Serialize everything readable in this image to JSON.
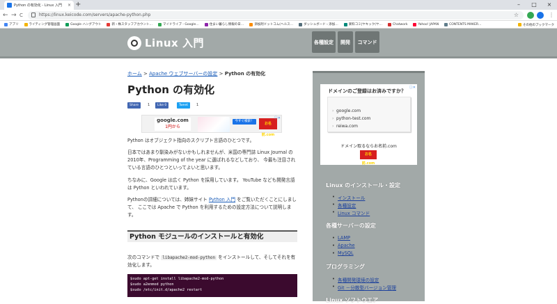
{
  "browser": {
    "tab_title": "Python の有効化 - Linux 入門",
    "tab_close": "×",
    "new_tab": "+",
    "win_min": "–",
    "win_max": "□",
    "win_close": "×",
    "back": "←",
    "forward": "→",
    "reload": "C",
    "url": "https://linux.keicode.com/servers/apache-python.php",
    "star": "☆",
    "bookmarks": [
      {
        "label": "アプリ",
        "color": "#4285f4"
      },
      {
        "label": "ライティング管理画面",
        "color": "#f4b400"
      },
      {
        "label": "Google ハングアウト",
        "color": "#0f9d58"
      },
      {
        "label": "新・株スタッフアカウント…",
        "color": "#e53935"
      },
      {
        "label": "マイドライブ - Google…",
        "color": "#34a853"
      },
      {
        "label": "住まい暮らし情報の日…",
        "color": "#8e24aa"
      },
      {
        "label": "添加剤ドットコム(ヘルス…",
        "color": "#fb8c00"
      },
      {
        "label": "ダッシュボード ‹ 添加…",
        "color": "#546e7a"
      },
      {
        "label": "楽料コミ|ヤキック(ヤ…",
        "color": "#00897b"
      },
      {
        "label": "Chatwork",
        "color": "#d32f2f"
      },
      {
        "label": "Yahoo! JAPAN",
        "color": "#ff0033"
      },
      {
        "label": "CONTENTS MAKER…",
        "color": "#607d8b"
      }
    ],
    "other_bookmarks": "その他のブックマーク"
  },
  "site": {
    "logo": "Linux 入門",
    "nav": [
      "各種設定",
      "開発",
      "コマンド"
    ]
  },
  "breadcrumb": {
    "home": "ホーム",
    "sep": " > ",
    "section": "Apache ウェブサーバーの設定",
    "current": "Python の有効化"
  },
  "page_title": "Python の有効化",
  "share": {
    "fb_label": "Share",
    "fb_count": "1",
    "like_label": "Like 0",
    "tweet_label": "Tweet",
    "tweet_count": "1"
  },
  "ad_banner": {
    "domain": "google.com",
    "price": "1円から",
    "cta": "今すぐ検索！",
    "brand": "お名前.com",
    "close": "ⓘ✕"
  },
  "paragraphs": {
    "p1": "Python はオブジェクト指向のスクリプト言語のひとつです。",
    "p2": "日本ではあまり馴染みがないかもしれませんが、米国の専門誌 Linux Journal の 2010年、Programming of the year に選ばれるなどしており、 今最も注目されている言語のひとつといってよいと思います。",
    "p3": "ちなみに、Google は広く Python を採用しています。 YouTube なども開発言語は Python といわれています。",
    "p4_a": "Pythonの詳細については、姉妹サイト ",
    "p4_link": "Python 入門",
    "p4_b": " をご覧いただくことにしまして、 ここでは Apache で Python を利用するための設定方法について説明します。",
    "p5_a": "次のコマンドで ",
    "p5_code": "libapache2-mod-python",
    "p5_b": " をインストールして、そしてそれを有効化します。"
  },
  "section_heading": "Python モジュールのインストールと有効化",
  "code_lines": [
    "$sudo apt-get install libapache2-mod-python",
    "$sudo a2enmod python",
    "$sudo /etc/init.d/apache2 restart"
  ],
  "sidebar": {
    "ad_title": "ドメインのご登録はお済みですか？",
    "ad_close": "ⓘ✕",
    "ad_items": [
      "google.com",
      "python-test.com",
      "reiwa.com"
    ],
    "ad_footer": "ドメイン取るならお名前.com",
    "ad_brand": "お名前.com",
    "sections": [
      {
        "heading": "Linux のインストール・設定",
        "links": [
          "インストール",
          "各種設定",
          "Linux コマンド"
        ]
      },
      {
        "heading": "各種サーバーの設定",
        "links": [
          "LAMP",
          "Apache",
          "MySQL"
        ]
      },
      {
        "heading": "プログラミング",
        "links": [
          "各種開発環境の設定",
          "Git －分散型バージョン管理"
        ]
      },
      {
        "heading": "Linux ソフトウエア",
        "links": []
      }
    ]
  }
}
